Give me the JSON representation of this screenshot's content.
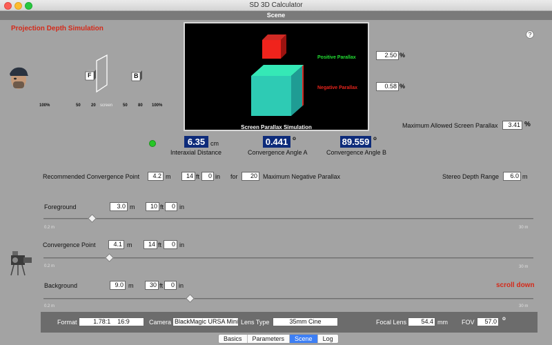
{
  "window": {
    "title": "SD 3D Calculator",
    "section": "Scene"
  },
  "projection": {
    "title": "Projection Depth Simulation",
    "cube_f": "F",
    "cube_b": "B",
    "scale": [
      "100%",
      "50",
      "20",
      "screen",
      "50",
      "80",
      "100%"
    ]
  },
  "simulation": {
    "title": "Screen Parallax Simulation",
    "positive_label": "Positive Parallax",
    "negative_label": "Negative Parallax",
    "positive_value": "2.50",
    "negative_value": "0.58",
    "percent": "%"
  },
  "max_parallax": {
    "label": "Maximum Allowed Screen Parallax",
    "value": "3.41",
    "unit": "%"
  },
  "interaxial": {
    "value": "6.35",
    "unit": "cm",
    "label": "Interaxial Distance"
  },
  "angle_a": {
    "value": "0.441",
    "unit": "o",
    "label": "Convergence Angle A"
  },
  "angle_b": {
    "value": "89.559",
    "unit": "o",
    "label": "Convergence Angle B"
  },
  "recommended": {
    "label": "Recommended Convergence Point",
    "m": "4.2",
    "m_unit": "m",
    "ft": "14",
    "ft_unit": "ft",
    "in": "0",
    "in_unit": "in",
    "for": "for",
    "for_value": "20",
    "suffix": "Maximum Negative Parallax"
  },
  "stereo_depth": {
    "label": "Stereo Depth Range",
    "value": "6.0",
    "unit": "m"
  },
  "foreground": {
    "label": "Foreground",
    "m": "3.0",
    "ft": "10",
    "in": "0",
    "min": "0.2 m",
    "max": "30 m",
    "level": 0.1
  },
  "convergence": {
    "label": "Convergence Point",
    "m": "4.1",
    "ft": "14",
    "in": "0",
    "min": "0.2 m",
    "max": "30 m",
    "level": 0.135
  },
  "background": {
    "label": "Background",
    "m": "9.0",
    "ft": "30",
    "in": "0",
    "min": "0.2 m",
    "max": "30 m",
    "level": 0.3
  },
  "units": {
    "m": "m",
    "ft": "ft",
    "in": "in"
  },
  "scroll_hint": "scroll down",
  "bottom": {
    "format_label": "Format",
    "format_value": "1.78:1    16:9",
    "camera_label": "Camera",
    "camera_value": "BlackMagic URSA Mini",
    "lens_type_label": "Lens Type",
    "lens_type_value": "35mm Cine",
    "focal_label": "Focal Lens",
    "focal_value": "54.4",
    "focal_unit": "mm",
    "fov_label": "FOV",
    "fov_value": "57.0",
    "fov_unit": "o"
  },
  "tabs": [
    {
      "label": "Basics",
      "active": false
    },
    {
      "label": "Parameters",
      "active": false
    },
    {
      "label": "Scene",
      "active": true
    },
    {
      "label": "Log",
      "active": false
    }
  ],
  "help_label": "?",
  "colors": {
    "accent_red": "#d42a1a",
    "value_blue": "#0d2b7a",
    "positive_green": "#22e033",
    "negative_red": "#e8241c",
    "status_green": "#26c726",
    "tab_active": "#3d7ff5"
  }
}
